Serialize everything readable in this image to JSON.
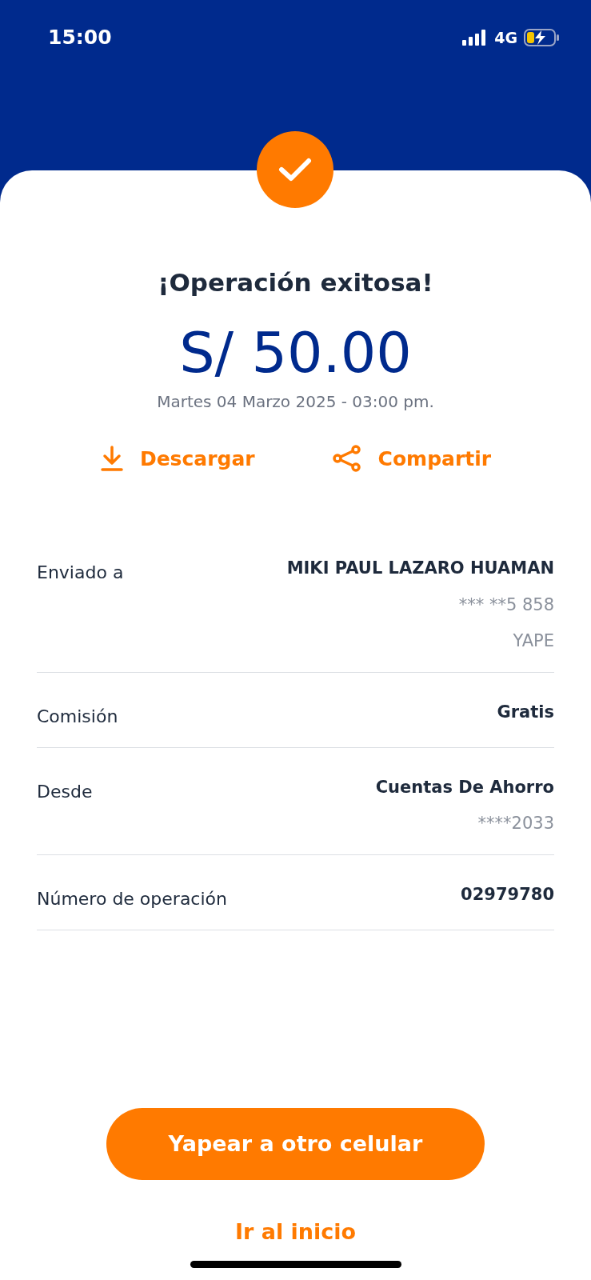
{
  "status_bar": {
    "time": "15:00",
    "network": "4G"
  },
  "title": "¡Operación exitosa!",
  "amount": "S/ 50.00",
  "date": "Martes 04 Marzo 2025 - 03:00 pm.",
  "actions": [
    {
      "kind": "download",
      "label": "Descargar"
    },
    {
      "kind": "share",
      "label": "Compartir"
    }
  ],
  "details": [
    {
      "label": "Enviado a",
      "values": [
        "MIKI PAUL LAZARO HUAMAN",
        "*** **5 858",
        "YAPE"
      ]
    },
    {
      "label": "Comisión",
      "values": [
        "Gratis"
      ]
    },
    {
      "label": "Desde",
      "values": [
        "Cuentas De Ahorro",
        "****2033"
      ]
    },
    {
      "label": "Número de operación",
      "values": [
        "02979780"
      ]
    }
  ],
  "primary_button": "Yapear a otro celular",
  "link": "Ir al inicio"
}
